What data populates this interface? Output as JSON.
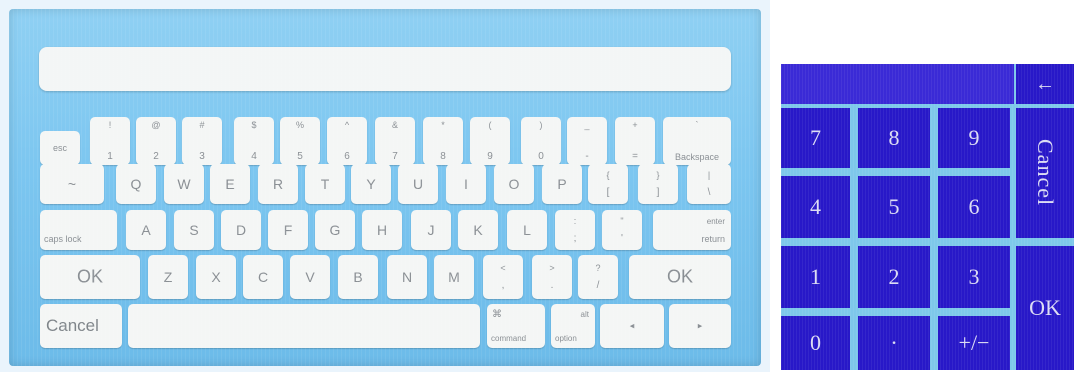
{
  "keyboard": {
    "display_value": "",
    "row1": [
      {
        "name": "esc-key",
        "top": "",
        "bottom": "esc",
        "single": true
      },
      {
        "name": "key-1",
        "top": "!",
        "bottom": "1"
      },
      {
        "name": "key-2",
        "top": "@",
        "bottom": "2"
      },
      {
        "name": "key-3",
        "top": "#",
        "bottom": "3"
      },
      {
        "name": "key-4",
        "top": "$",
        "bottom": "4"
      },
      {
        "name": "key-5",
        "top": "%",
        "bottom": "5"
      },
      {
        "name": "key-6",
        "top": "^",
        "bottom": "6"
      },
      {
        "name": "key-7",
        "top": "&",
        "bottom": "7"
      },
      {
        "name": "key-8",
        "top": "*",
        "bottom": "8"
      },
      {
        "name": "key-9",
        "top": "(",
        "bottom": "9"
      },
      {
        "name": "key-0",
        "top": ")",
        "bottom": "0"
      },
      {
        "name": "key-minus",
        "top": "_",
        "bottom": "-"
      },
      {
        "name": "key-equals",
        "top": "+",
        "bottom": "="
      },
      {
        "name": "backspace-key",
        "top": "`",
        "bottom": "Backspace"
      }
    ],
    "row2": [
      {
        "name": "key-tilde",
        "top": "",
        "bottom": "~",
        "center": true
      },
      {
        "name": "key-q",
        "label": "Q"
      },
      {
        "name": "key-w",
        "label": "W"
      },
      {
        "name": "key-e",
        "label": "E"
      },
      {
        "name": "key-r",
        "label": "R"
      },
      {
        "name": "key-t",
        "label": "T"
      },
      {
        "name": "key-y",
        "label": "Y"
      },
      {
        "name": "key-u",
        "label": "U"
      },
      {
        "name": "key-i",
        "label": "I"
      },
      {
        "name": "key-o",
        "label": "O"
      },
      {
        "name": "key-p",
        "label": "P"
      },
      {
        "name": "key-left-brace",
        "top": "{",
        "bottom": "["
      },
      {
        "name": "key-right-brace",
        "top": "}",
        "bottom": "]"
      },
      {
        "name": "key-pipe",
        "top": "|",
        "bottom": "\\"
      }
    ],
    "row3": {
      "caps_lock": "caps lock",
      "letters": [
        "A",
        "S",
        "D",
        "F",
        "G",
        "H",
        "J",
        "K",
        "L"
      ],
      "semicolon": {
        "top": ":",
        "bottom": ";"
      },
      "quote": {
        "top": "\"",
        "bottom": "'"
      },
      "enter_top": "enter",
      "enter_bottom": "return"
    },
    "row4": {
      "ok_left": "OK",
      "letters": [
        "Z",
        "X",
        "C",
        "V",
        "B",
        "N",
        "M"
      ],
      "comma": {
        "top": "<",
        "bottom": ","
      },
      "period": {
        "top": ">",
        "bottom": "."
      },
      "slash": {
        "top": "?",
        "bottom": "/"
      },
      "ok_right": "OK"
    },
    "row5": {
      "cancel": "Cancel",
      "command_symbol": "⌘",
      "command": "command",
      "alt": "alt",
      "option": "option",
      "left_arrow": "◂",
      "right_arrow": "▸"
    }
  },
  "numpad": {
    "display_value": "",
    "backspace_arrow": "←",
    "keys": [
      "7",
      "8",
      "9",
      "4",
      "5",
      "6",
      "1",
      "2",
      "3",
      "0",
      "·",
      "+/−"
    ],
    "cancel": "Cancel",
    "ok": "OK"
  }
}
